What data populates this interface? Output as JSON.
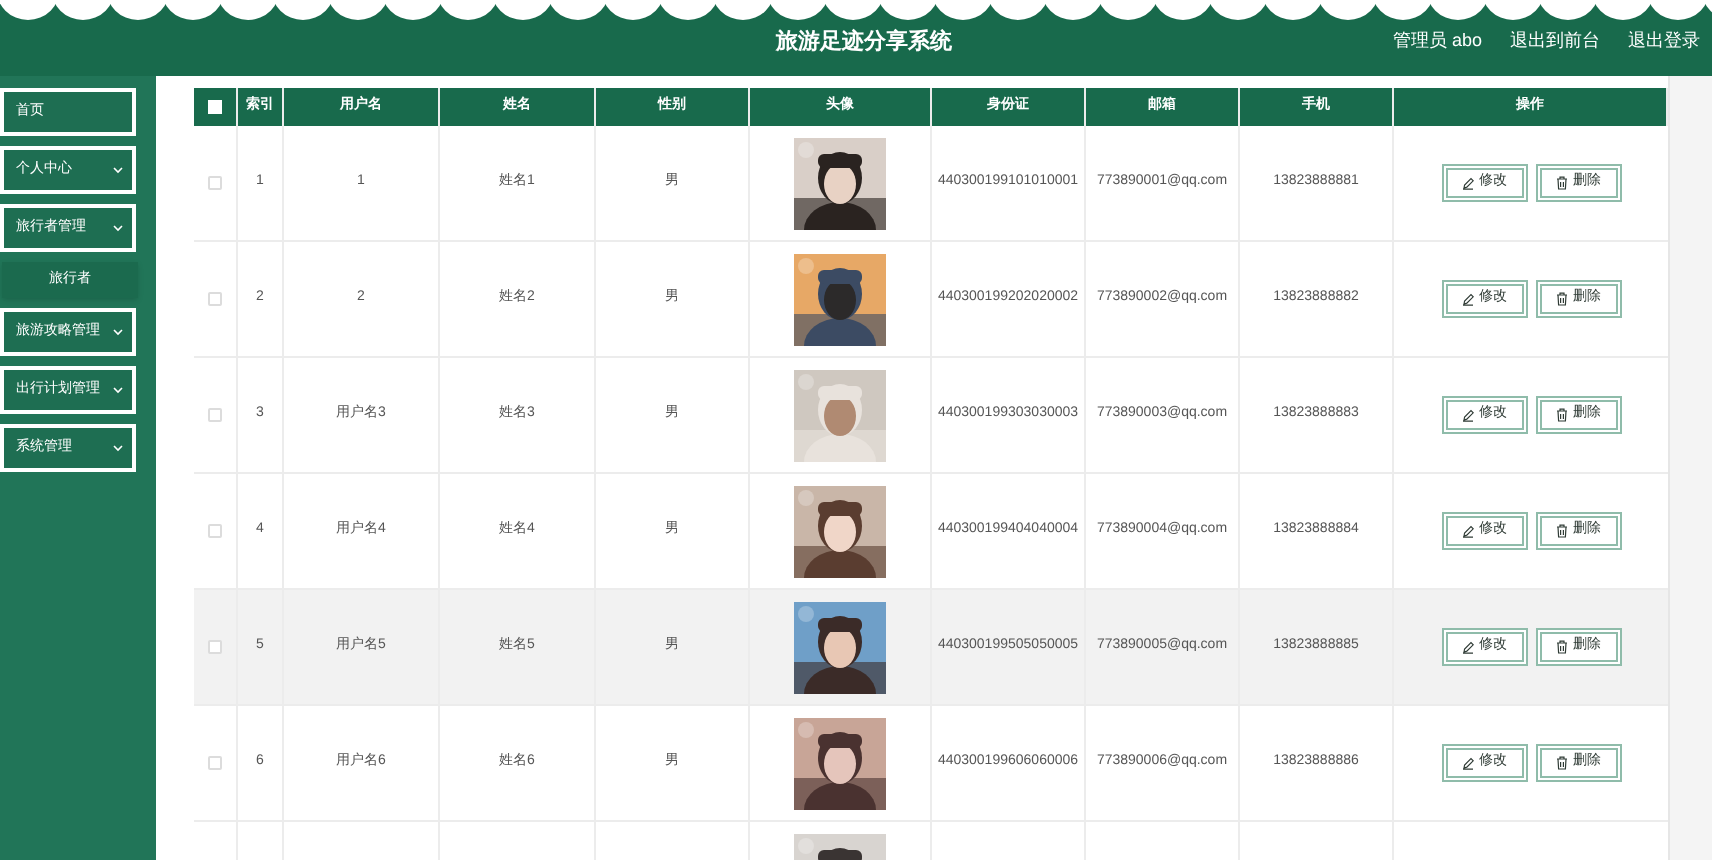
{
  "header": {
    "title": "旅游足迹分享系统",
    "links": [
      "管理员 abo",
      "退出到前台",
      "退出登录"
    ]
  },
  "sidebar": {
    "items": [
      {
        "label": "首页",
        "expandable": false
      },
      {
        "label": "个人中心",
        "expandable": true
      },
      {
        "label": "旅行者管理",
        "expandable": true,
        "children": [
          {
            "label": "旅行者"
          }
        ]
      },
      {
        "label": "旅游攻略管理",
        "expandable": true
      },
      {
        "label": "出行计划管理",
        "expandable": true
      },
      {
        "label": "系统管理",
        "expandable": true
      }
    ]
  },
  "table": {
    "select_all_checked": false,
    "columns": [
      "索引",
      "用户名",
      "姓名",
      "性别",
      "头像",
      "身份证",
      "邮箱",
      "手机",
      "操作"
    ],
    "rows": [
      {
        "checked": false,
        "highlighted": false,
        "index": "1",
        "username": "1",
        "name": "姓名1",
        "gender": "男",
        "avatar": {
          "kind": "picture"
        },
        "id_card": "440300199101010001",
        "email": "773890001@qq.com",
        "phone": "13823888881",
        "actions": [
          "修改",
          "删除"
        ]
      },
      {
        "checked": false,
        "highlighted": false,
        "index": "2",
        "username": "2",
        "name": "姓名2",
        "gender": "男",
        "avatar": {
          "kind": "picture"
        },
        "id_card": "440300199202020002",
        "email": "773890002@qq.com",
        "phone": "13823888882",
        "actions": [
          "修改",
          "删除"
        ]
      },
      {
        "checked": false,
        "highlighted": false,
        "index": "3",
        "username": "用户名3",
        "name": "姓名3",
        "gender": "男",
        "avatar": {
          "kind": "picture"
        },
        "id_card": "440300199303030003",
        "email": "773890003@qq.com",
        "phone": "13823888883",
        "actions": [
          "修改",
          "删除"
        ]
      },
      {
        "checked": false,
        "highlighted": false,
        "index": "4",
        "username": "用户名4",
        "name": "姓名4",
        "gender": "男",
        "avatar": {
          "kind": "picture"
        },
        "id_card": "440300199404040004",
        "email": "773890004@qq.com",
        "phone": "13823888884",
        "actions": [
          "修改",
          "删除"
        ]
      },
      {
        "checked": false,
        "highlighted": true,
        "index": "5",
        "username": "用户名5",
        "name": "姓名5",
        "gender": "男",
        "avatar": {
          "kind": "picture"
        },
        "id_card": "440300199505050005",
        "email": "773890005@qq.com",
        "phone": "13823888885",
        "actions": [
          "修改",
          "删除"
        ]
      },
      {
        "checked": false,
        "highlighted": false,
        "index": "6",
        "username": "用户名6",
        "name": "姓名6",
        "gender": "男",
        "avatar": {
          "kind": "picture"
        },
        "id_card": "440300199606060006",
        "email": "773890006@qq.com",
        "phone": "13823888886",
        "actions": [
          "修改",
          "删除"
        ]
      },
      {
        "avatar": {
          "kind": "picture"
        }
      }
    ]
  }
}
